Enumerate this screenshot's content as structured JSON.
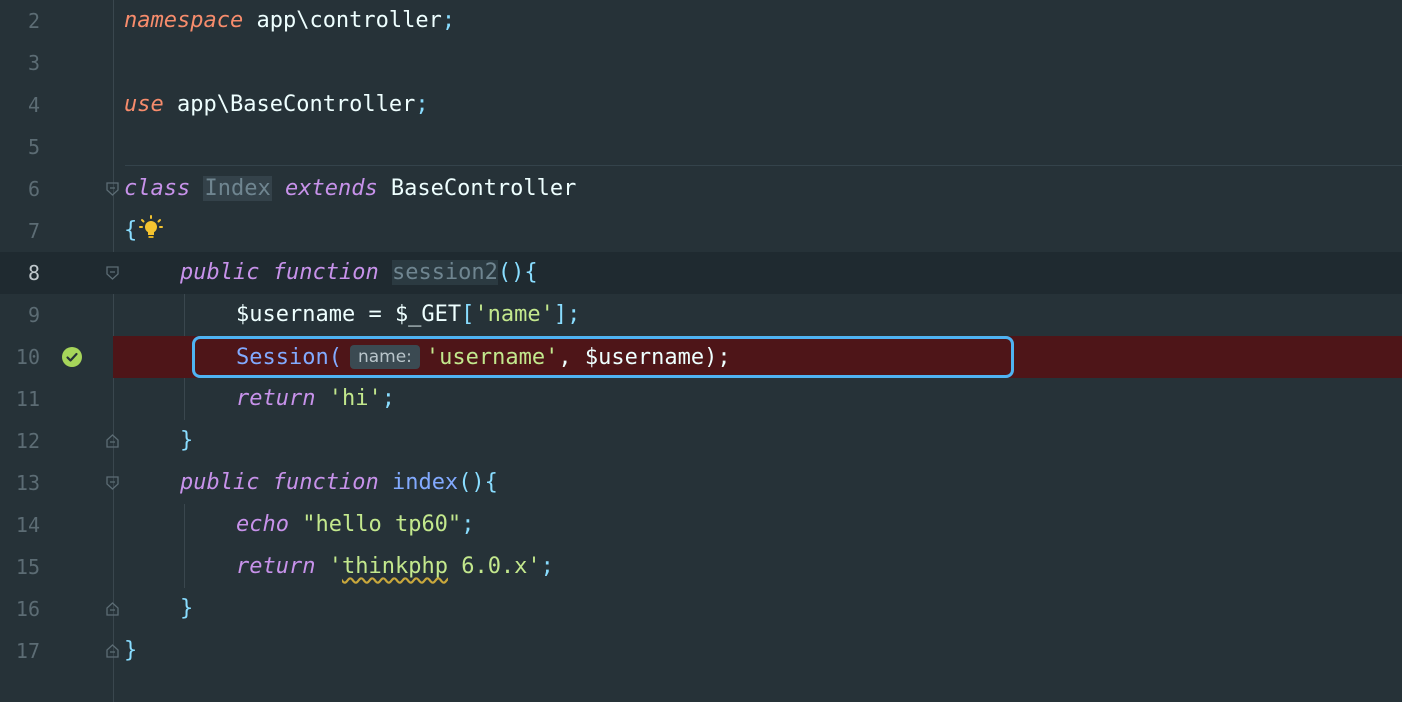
{
  "editor": {
    "lines": [
      {
        "n": "2",
        "tokens": [
          "namespace",
          " app\\controller",
          ";"
        ]
      },
      {
        "n": "3"
      },
      {
        "n": "4",
        "tokens": [
          "use",
          " app\\BaseController",
          ";"
        ]
      },
      {
        "n": "5"
      },
      {
        "n": "6",
        "tokens": [
          "class",
          " ",
          "Index",
          " ",
          "extends",
          " BaseController"
        ]
      },
      {
        "n": "7",
        "tokens": [
          "{"
        ]
      },
      {
        "n": "8",
        "tokens": [
          "public",
          " ",
          "function",
          " ",
          "session2",
          "(){"
        ]
      },
      {
        "n": "9",
        "tokens": [
          "$username = $_GET",
          "[",
          "'name'",
          "];"
        ]
      },
      {
        "n": "10",
        "tokens": [
          "Session(",
          "name:",
          "'username'",
          ", $username);"
        ]
      },
      {
        "n": "11",
        "tokens": [
          "return",
          " ",
          "'hi'",
          ";"
        ]
      },
      {
        "n": "12",
        "tokens": [
          "}"
        ]
      },
      {
        "n": "13",
        "tokens": [
          "public",
          " ",
          "function",
          " ",
          "index",
          "(){"
        ]
      },
      {
        "n": "14",
        "tokens": [
          "echo",
          " ",
          "\"hello tp60\"",
          ";"
        ]
      },
      {
        "n": "15",
        "tokens": [
          "return",
          " ",
          "'",
          "thinkphp",
          " 6.0.x'",
          ";"
        ]
      },
      {
        "n": "16",
        "tokens": [
          "}"
        ]
      },
      {
        "n": "17",
        "tokens": [
          "}"
        ]
      }
    ]
  },
  "colors": {
    "background": "#263238",
    "breakpoint_line": "#4e1518",
    "focus_border": "#4fb3f2",
    "keyword": "#c792ea",
    "keyword_alt": "#f78c6c",
    "string": "#c3e88d",
    "function": "#82aaff"
  },
  "icons": {
    "line10_gutter": "check-circle-icon",
    "line7_inline": "lightbulb-icon",
    "fold_markers": "fold-marker-icon"
  }
}
